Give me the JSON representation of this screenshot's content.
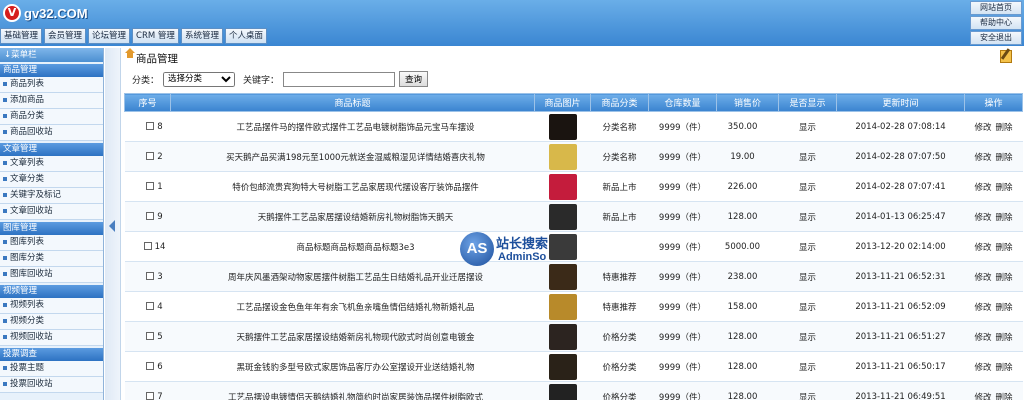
{
  "brand": {
    "logo_letter": "V",
    "site": "gv32.COM"
  },
  "topnav": [
    "基础管理",
    "会员管理",
    "论坛管理",
    "CRM 管理",
    "系统管理",
    "个人桌面"
  ],
  "quick_links": [
    "网站首页",
    "帮助中心",
    "安全退出"
  ],
  "sidebar": {
    "header": "↓菜单栏",
    "groups": [
      {
        "title": "商品管理",
        "items": [
          "商品列表",
          "添加商品",
          "商品分类",
          "商品回收站"
        ]
      },
      {
        "title": "文章管理",
        "items": [
          "文章列表",
          "文章分类",
          "关键字及标记",
          "文章回收站"
        ]
      },
      {
        "title": "图库管理",
        "items": [
          "图库列表",
          "图库分类",
          "图库回收站"
        ]
      },
      {
        "title": "视频管理",
        "items": [
          "视频列表",
          "视频分类",
          "视频回收站"
        ]
      },
      {
        "title": "投票调查",
        "items": [
          "投票主题",
          "投票回收站"
        ]
      }
    ]
  },
  "main": {
    "title": "商品管理",
    "filter": {
      "category_label": "分类：",
      "category_selected": "选择分类",
      "keyword_label": "关键字：",
      "keyword_value": "",
      "search_button": "查询"
    },
    "columns": [
      "序号",
      "商品标题",
      "商品图片",
      "商品分类",
      "仓库数量",
      "销售价",
      "是否显示",
      "更新时间",
      "操作"
    ],
    "actions": {
      "edit": "修改",
      "delete": "删除"
    },
    "rows": [
      {
        "id": "8",
        "title": "工艺品摆件马的摆件欧式摆件工艺品电镀树脂饰品元宝马车摆设",
        "category": "分类名称",
        "stock": "9999（件）",
        "price": "350.00",
        "show": "显示",
        "updated": "2014-02-28 07:08:14",
        "thumb_color": "#1a1410"
      },
      {
        "id": "2",
        "title": "买天鹅产品买满198元至1000元就送金湿威粮湿见详情结婚喜庆礼物",
        "category": "分类名称",
        "stock": "9999（件）",
        "price": "19.00",
        "show": "显示",
        "updated": "2014-02-28 07:07:50",
        "thumb_color": "#d8b84a"
      },
      {
        "id": "1",
        "title": "特价包邮流贵宾狗特大号树脂工艺品家居现代摆设客厅装饰品摆件",
        "category": "新品上市",
        "stock": "9999（件）",
        "price": "226.00",
        "show": "显示",
        "updated": "2014-02-28 07:07:41",
        "thumb_color": "#c41c3c"
      },
      {
        "id": "9",
        "title": "天鹅摆件工艺品家居摆设结婚新房礼物树脂饰天鹅天",
        "category": "新品上市",
        "stock": "9999（件）",
        "price": "128.00",
        "show": "显示",
        "updated": "2014-01-13 06:25:47",
        "thumb_color": "#2a2a2a"
      },
      {
        "id": "14",
        "title": "商品标题商品标题商品标题3e3",
        "category": "",
        "stock": "9999（件）",
        "price": "5000.00",
        "show": "显示",
        "updated": "2013-12-20 02:14:00",
        "thumb_color": "#3a3a3a"
      },
      {
        "id": "3",
        "title": "周年庆风墨酒架动物家居摆件树脂工艺品生日结婚礼品开业迁居摆设",
        "category": "特惠推荐",
        "stock": "9999（件）",
        "price": "238.00",
        "show": "显示",
        "updated": "2013-11-21 06:52:31",
        "thumb_color": "#3b2a18"
      },
      {
        "id": "4",
        "title": "工艺品摆设金色鱼年年有余飞机鱼亲嘴鱼情侣结婚礼物新婚礼品",
        "category": "特惠推荐",
        "stock": "9999（件）",
        "price": "158.00",
        "show": "显示",
        "updated": "2013-11-21 06:52:09",
        "thumb_color": "#b88a2a"
      },
      {
        "id": "5",
        "title": "天鹅摆件工艺品家居摆设结婚新房礼物现代欧式时尚创意电镀金",
        "category": "价格分类",
        "stock": "9999（件）",
        "price": "128.00",
        "show": "显示",
        "updated": "2013-11-21 06:51:27",
        "thumb_color": "#2c2420"
      },
      {
        "id": "6",
        "title": "黑斑金钱豹多型号欧式家居饰品客厅办公室摆设开业送结婚礼物",
        "category": "价格分类",
        "stock": "9999（件）",
        "price": "128.00",
        "show": "显示",
        "updated": "2013-11-21 06:50:17",
        "thumb_color": "#2a2218"
      },
      {
        "id": "7",
        "title": "工艺品摆设电镀情侣天鹅结婚礼物简约时尚家居装饰品摆件树脂欧式",
        "category": "价格分类",
        "stock": "9999（件）",
        "price": "128.00",
        "show": "显示",
        "updated": "2013-11-21 06:49:51",
        "thumb_color": "#222222"
      }
    ]
  },
  "watermark": {
    "mark": "AS",
    "cn": "站长搜索",
    "en": "AdminSo"
  }
}
